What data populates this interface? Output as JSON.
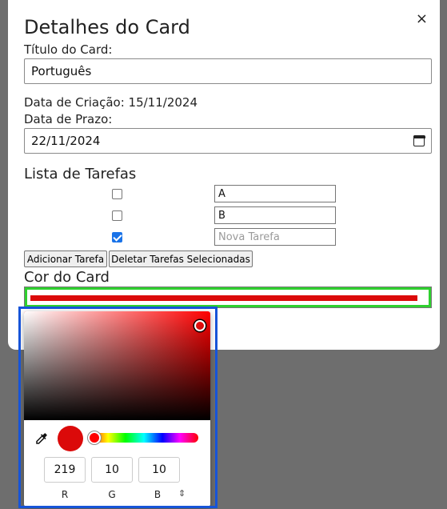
{
  "modal": {
    "title": "Detalhes do Card",
    "close_label": "×",
    "title_label": "Título do Card:",
    "title_value": "Português",
    "created_label": "Data de Criação: 15/11/2024",
    "due_label": "Data de Prazo:",
    "due_value": "22/11/2024",
    "tasks_heading": "Lista de Tarefas",
    "tasks": [
      {
        "checked": false,
        "value": "A"
      },
      {
        "checked": false,
        "value": "B"
      },
      {
        "checked": true,
        "value": "",
        "placeholder": "Nova Tarefa"
      }
    ],
    "add_task_button": "Adicionar Tarefa",
    "delete_tasks_button": "Deletar Tarefas Selecionadas",
    "color_label": "Cor do Card",
    "color_value": "#db0a0a"
  },
  "color_picker": {
    "r": "219",
    "g": "10",
    "b": "10",
    "r_label": "R",
    "g_label": "G",
    "b_label": "B",
    "mode_toggle": "⇕"
  },
  "colors": {
    "selected": "#db0a0a",
    "focus_ring": "#2fd02f",
    "highlight": "#1654d8"
  }
}
